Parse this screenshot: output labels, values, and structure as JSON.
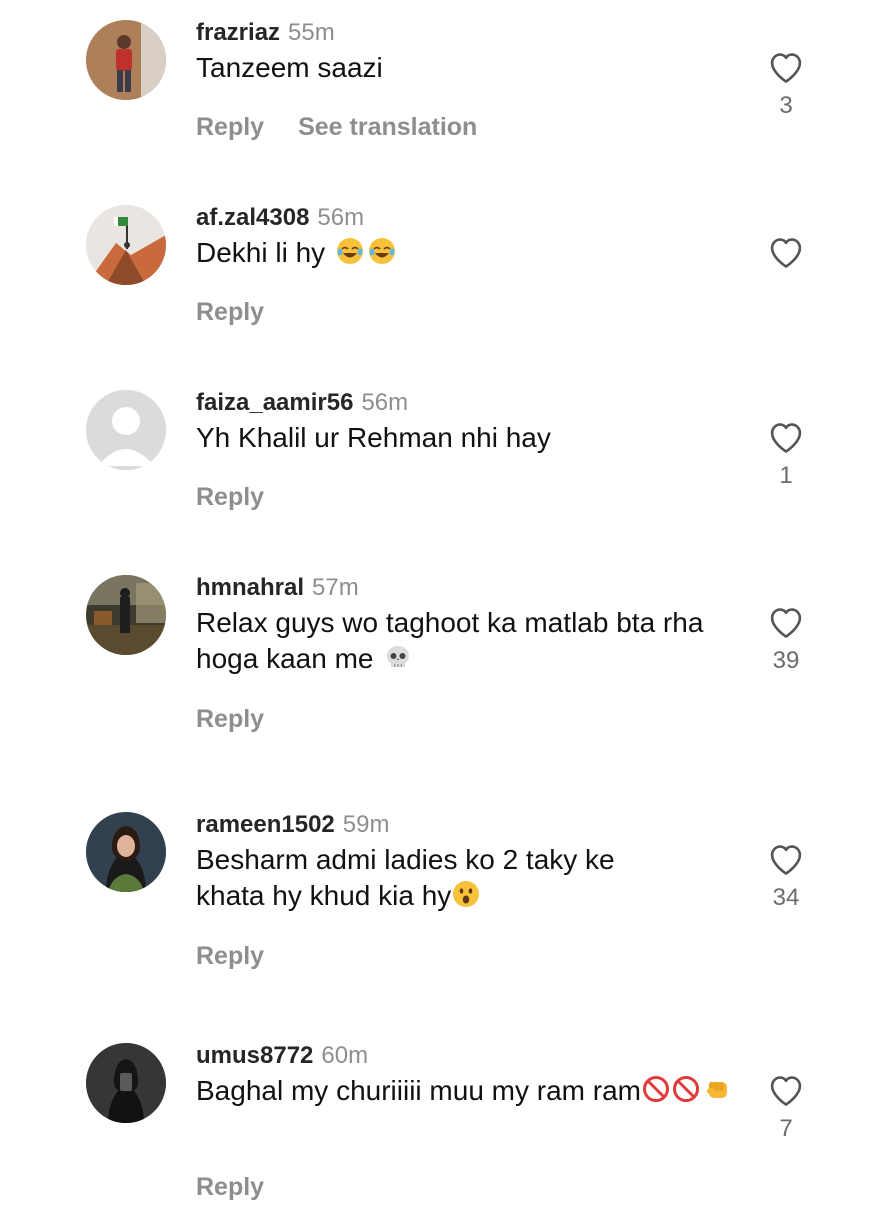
{
  "comments": [
    {
      "username": "frazriaz",
      "time": "55m",
      "text": "Tanzeem saazi",
      "emojis": [],
      "reply_label": "Reply",
      "translate_label": "See translation",
      "like_count": "3",
      "avatar": "person-standing-avatar"
    },
    {
      "username": "af.zal4308",
      "time": "56m",
      "text": "Dekhi li hy ",
      "emojis": [
        "laughing-tears-emoji",
        "laughing-tears-emoji"
      ],
      "reply_label": "Reply",
      "like_count": "",
      "avatar": "mountain-flag-avatar"
    },
    {
      "username": "faiza_aamir56",
      "time": "56m",
      "text": "Yh Khalil ur Rehman nhi hay",
      "emojis": [],
      "reply_label": "Reply",
      "like_count": "1",
      "avatar": "default-user-avatar"
    },
    {
      "username": "hmnahral",
      "time": "57m",
      "text": "Relax guys wo taghoot ka matlab bta rha hoga kaan me ",
      "emojis": [
        "skull-emoji"
      ],
      "reply_label": "Reply",
      "like_count": "39",
      "avatar": "night-scene-avatar"
    },
    {
      "username": "rameen1502",
      "time": "59m",
      "text": "Besharm admi ladies ko 2 taky ke khata hy khud kia hy",
      "emojis": [
        "surprised-face-emoji"
      ],
      "reply_label": "Reply",
      "like_count": "34",
      "avatar": "woman-portrait-avatar"
    },
    {
      "username": "umus8772",
      "time": "60m",
      "text": "Baghal my churiiiii muu my ram ram",
      "emojis": [
        "prohibited-emoji",
        "prohibited-emoji",
        "fist-emoji"
      ],
      "reply_label": "Reply",
      "like_count": "7",
      "avatar": "dark-mirror-selfie-avatar"
    }
  ],
  "colors": {
    "username": "#262626",
    "secondary": "#8e8e8e",
    "text": "#111111",
    "heart_outline": "#555555"
  }
}
